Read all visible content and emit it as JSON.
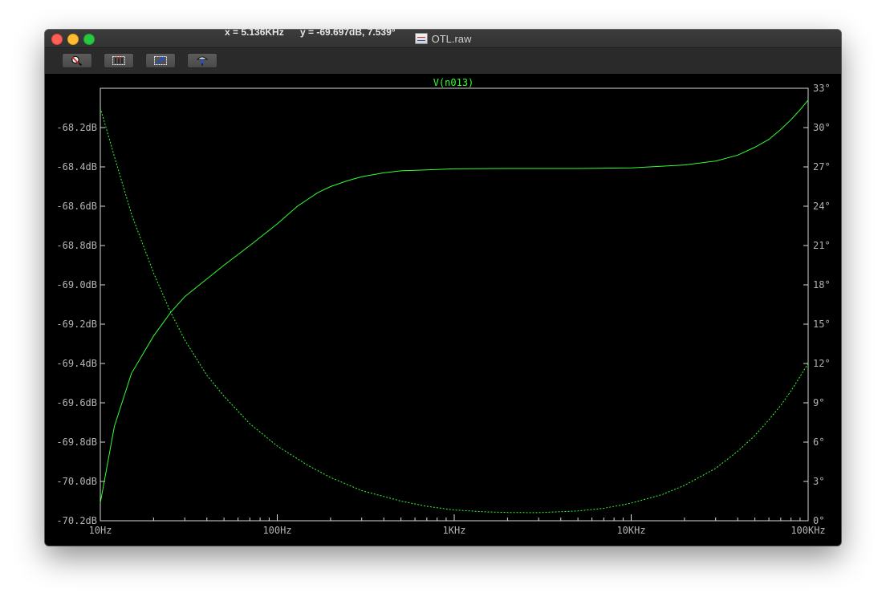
{
  "window": {
    "title": "OTL.raw",
    "icons": [
      "zoom-area-icon",
      "autorange-icon",
      "pan-icon",
      "probe-icon"
    ]
  },
  "readout": {
    "x": "x = 5.136KHz",
    "y": "y = -69.697dB, 7.539°"
  },
  "colors": {
    "background": "#000000",
    "axis": "#d8d8d8",
    "tick_text": "#b4b4b4",
    "trace": "#33ff33"
  },
  "chart_data": {
    "type": "line",
    "title": "V(n013)",
    "xscale": "log",
    "xlim": [
      10,
      100000
    ],
    "ylim": [
      -70.2,
      -68.0
    ],
    "y2lim": [
      0,
      33
    ],
    "grid": false,
    "x_ticks": [
      {
        "value": 10,
        "label": "10Hz"
      },
      {
        "value": 100,
        "label": "100Hz"
      },
      {
        "value": 1000,
        "label": "1KHz"
      },
      {
        "value": 10000,
        "label": "10KHz"
      },
      {
        "value": 100000,
        "label": "100KHz"
      }
    ],
    "y_ticks": [
      {
        "value": -68.2,
        "label": "-68.2dB"
      },
      {
        "value": -68.4,
        "label": "-68.4dB"
      },
      {
        "value": -68.6,
        "label": "-68.6dB"
      },
      {
        "value": -68.8,
        "label": "-68.8dB"
      },
      {
        "value": -69.0,
        "label": "-69.0dB"
      },
      {
        "value": -69.2,
        "label": "-69.2dB"
      },
      {
        "value": -69.4,
        "label": "-69.4dB"
      },
      {
        "value": -69.6,
        "label": "-69.6dB"
      },
      {
        "value": -69.8,
        "label": "-69.8dB"
      },
      {
        "value": -70.0,
        "label": "-70.0dB"
      },
      {
        "value": -70.2,
        "label": "-70.2dB"
      }
    ],
    "y2_ticks": [
      {
        "value": 33,
        "label": "33°"
      },
      {
        "value": 30,
        "label": "30°"
      },
      {
        "value": 27,
        "label": "27°"
      },
      {
        "value": 24,
        "label": "24°"
      },
      {
        "value": 21,
        "label": "21°"
      },
      {
        "value": 18,
        "label": "18°"
      },
      {
        "value": 15,
        "label": "15°"
      },
      {
        "value": 12,
        "label": "12°"
      },
      {
        "value": 9,
        "label": "9°"
      },
      {
        "value": 6,
        "label": "6°"
      },
      {
        "value": 3,
        "label": "3°"
      },
      {
        "value": 0,
        "label": "0°"
      }
    ],
    "series": [
      {
        "kind": "magnitude",
        "axis": "left",
        "style": "solid",
        "x": [
          10,
          12,
          15,
          20,
          25,
          30,
          40,
          50,
          70,
          100,
          130,
          170,
          200,
          250,
          300,
          400,
          500,
          700,
          1000,
          2000,
          5000,
          10000,
          20000,
          30000,
          40000,
          50000,
          60000,
          70000,
          80000,
          90000,
          100000
        ],
        "y": [
          -70.11,
          -69.72,
          -69.45,
          -69.26,
          -69.14,
          -69.06,
          -68.97,
          -68.9,
          -68.8,
          -68.69,
          -68.6,
          -68.53,
          -68.5,
          -68.47,
          -68.45,
          -68.43,
          -68.42,
          -68.415,
          -68.41,
          -68.408,
          -68.408,
          -68.405,
          -68.39,
          -68.37,
          -68.34,
          -68.3,
          -68.26,
          -68.21,
          -68.16,
          -68.11,
          -68.06
        ]
      },
      {
        "kind": "phase",
        "axis": "right",
        "style": "dashed",
        "x": [
          10,
          12,
          15,
          20,
          25,
          30,
          40,
          50,
          70,
          100,
          150,
          200,
          300,
          500,
          700,
          1000,
          1500,
          2000,
          3000,
          5000,
          7000,
          10000,
          15000,
          20000,
          30000,
          40000,
          50000,
          60000,
          70000,
          80000,
          90000,
          100000
        ],
        "y": [
          31.5,
          27.8,
          23.4,
          18.9,
          15.9,
          13.8,
          11.1,
          9.5,
          7.4,
          5.7,
          4.2,
          3.3,
          2.3,
          1.5,
          1.1,
          0.82,
          0.68,
          0.63,
          0.62,
          0.75,
          0.95,
          1.35,
          2.0,
          2.7,
          4.0,
          5.3,
          6.5,
          7.7,
          8.8,
          9.9,
          11.0,
          12.0
        ]
      }
    ]
  }
}
